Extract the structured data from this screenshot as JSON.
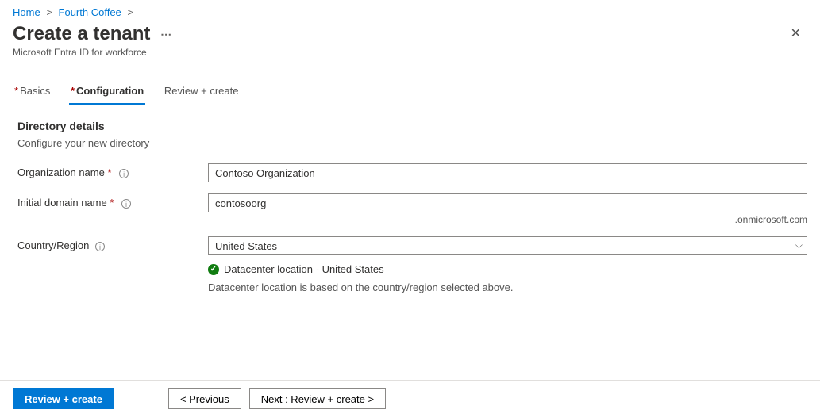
{
  "breadcrumb": {
    "home": "Home",
    "item": "Fourth Coffee"
  },
  "header": {
    "title": "Create a tenant",
    "subtitle": "Microsoft Entra ID for workforce"
  },
  "tabs": {
    "basics": "Basics",
    "config": "Configuration",
    "review": "Review + create"
  },
  "section": {
    "title": "Directory details",
    "subtitle": "Configure your new directory"
  },
  "fields": {
    "org_label": "Organization name",
    "org_value": "Contoso Organization",
    "domain_label": "Initial domain name",
    "domain_value": "contosoorg",
    "domain_suffix": ".onmicrosoft.com",
    "region_label": "Country/Region",
    "region_value": "United States"
  },
  "datacenter": {
    "line": "Datacenter location - United States",
    "note": "Datacenter location is based on the country/region selected above."
  },
  "footer": {
    "review": "Review + create",
    "previous": "< Previous",
    "next": "Next : Review + create >"
  }
}
